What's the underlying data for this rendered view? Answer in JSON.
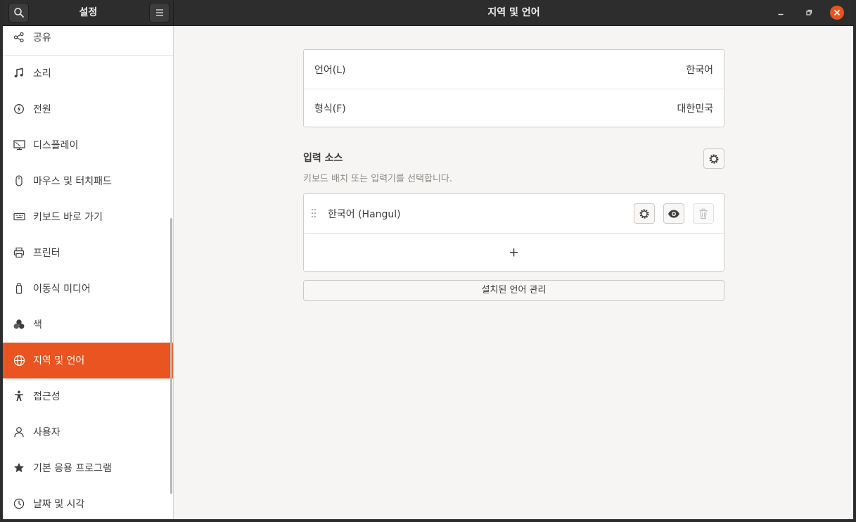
{
  "header": {
    "sidebar_title": "설정",
    "main_title": "지역 및 언어"
  },
  "sidebar": {
    "items": [
      {
        "label": "공유",
        "icon": "share-icon"
      },
      {
        "label": "소리",
        "icon": "music-note-icon"
      },
      {
        "label": "전원",
        "icon": "power-icon"
      },
      {
        "label": "디스플레이",
        "icon": "display-icon"
      },
      {
        "label": "마우스 및 터치패드",
        "icon": "mouse-icon"
      },
      {
        "label": "키보드 바로 가기",
        "icon": "keyboard-icon"
      },
      {
        "label": "프린터",
        "icon": "printer-icon"
      },
      {
        "label": "이동식 미디어",
        "icon": "usb-drive-icon"
      },
      {
        "label": "색",
        "icon": "color-icon"
      },
      {
        "label": "지역 및 언어",
        "icon": "globe-icon",
        "active": true
      },
      {
        "label": "접근성",
        "icon": "accessibility-icon"
      },
      {
        "label": "사용자",
        "icon": "user-icon"
      },
      {
        "label": "기본 응용 프로그램",
        "icon": "star-icon"
      },
      {
        "label": "날짜 및 시각",
        "icon": "clock-icon"
      }
    ]
  },
  "region": {
    "language_label": "언어(L)",
    "language_value": "한국어",
    "formats_label": "형식(F)",
    "formats_value": "대한민국"
  },
  "input_sources": {
    "title": "입력 소스",
    "subtitle": "키보드 배치 또는 입력기를 선택합니다.",
    "items": [
      {
        "label": "한국어 (Hangul)"
      }
    ],
    "add_label": "+",
    "manage_button": "설치된 언어 관리"
  },
  "colors": {
    "accent": "#e95420",
    "titlebar": "#2d2d2d"
  }
}
